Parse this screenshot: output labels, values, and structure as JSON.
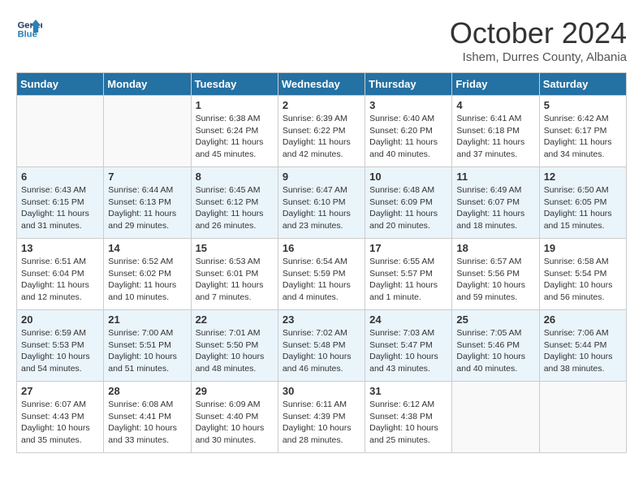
{
  "header": {
    "logo_line1": "General",
    "logo_line2": "Blue",
    "month": "October 2024",
    "location": "Ishem, Durres County, Albania"
  },
  "weekdays": [
    "Sunday",
    "Monday",
    "Tuesday",
    "Wednesday",
    "Thursday",
    "Friday",
    "Saturday"
  ],
  "weeks": [
    [
      {
        "day": "",
        "info": ""
      },
      {
        "day": "",
        "info": ""
      },
      {
        "day": "1",
        "info": "Sunrise: 6:38 AM\nSunset: 6:24 PM\nDaylight: 11 hours and 45 minutes."
      },
      {
        "day": "2",
        "info": "Sunrise: 6:39 AM\nSunset: 6:22 PM\nDaylight: 11 hours and 42 minutes."
      },
      {
        "day": "3",
        "info": "Sunrise: 6:40 AM\nSunset: 6:20 PM\nDaylight: 11 hours and 40 minutes."
      },
      {
        "day": "4",
        "info": "Sunrise: 6:41 AM\nSunset: 6:18 PM\nDaylight: 11 hours and 37 minutes."
      },
      {
        "day": "5",
        "info": "Sunrise: 6:42 AM\nSunset: 6:17 PM\nDaylight: 11 hours and 34 minutes."
      }
    ],
    [
      {
        "day": "6",
        "info": "Sunrise: 6:43 AM\nSunset: 6:15 PM\nDaylight: 11 hours and 31 minutes."
      },
      {
        "day": "7",
        "info": "Sunrise: 6:44 AM\nSunset: 6:13 PM\nDaylight: 11 hours and 29 minutes."
      },
      {
        "day": "8",
        "info": "Sunrise: 6:45 AM\nSunset: 6:12 PM\nDaylight: 11 hours and 26 minutes."
      },
      {
        "day": "9",
        "info": "Sunrise: 6:47 AM\nSunset: 6:10 PM\nDaylight: 11 hours and 23 minutes."
      },
      {
        "day": "10",
        "info": "Sunrise: 6:48 AM\nSunset: 6:09 PM\nDaylight: 11 hours and 20 minutes."
      },
      {
        "day": "11",
        "info": "Sunrise: 6:49 AM\nSunset: 6:07 PM\nDaylight: 11 hours and 18 minutes."
      },
      {
        "day": "12",
        "info": "Sunrise: 6:50 AM\nSunset: 6:05 PM\nDaylight: 11 hours and 15 minutes."
      }
    ],
    [
      {
        "day": "13",
        "info": "Sunrise: 6:51 AM\nSunset: 6:04 PM\nDaylight: 11 hours and 12 minutes."
      },
      {
        "day": "14",
        "info": "Sunrise: 6:52 AM\nSunset: 6:02 PM\nDaylight: 11 hours and 10 minutes."
      },
      {
        "day": "15",
        "info": "Sunrise: 6:53 AM\nSunset: 6:01 PM\nDaylight: 11 hours and 7 minutes."
      },
      {
        "day": "16",
        "info": "Sunrise: 6:54 AM\nSunset: 5:59 PM\nDaylight: 11 hours and 4 minutes."
      },
      {
        "day": "17",
        "info": "Sunrise: 6:55 AM\nSunset: 5:57 PM\nDaylight: 11 hours and 1 minute."
      },
      {
        "day": "18",
        "info": "Sunrise: 6:57 AM\nSunset: 5:56 PM\nDaylight: 10 hours and 59 minutes."
      },
      {
        "day": "19",
        "info": "Sunrise: 6:58 AM\nSunset: 5:54 PM\nDaylight: 10 hours and 56 minutes."
      }
    ],
    [
      {
        "day": "20",
        "info": "Sunrise: 6:59 AM\nSunset: 5:53 PM\nDaylight: 10 hours and 54 minutes."
      },
      {
        "day": "21",
        "info": "Sunrise: 7:00 AM\nSunset: 5:51 PM\nDaylight: 10 hours and 51 minutes."
      },
      {
        "day": "22",
        "info": "Sunrise: 7:01 AM\nSunset: 5:50 PM\nDaylight: 10 hours and 48 minutes."
      },
      {
        "day": "23",
        "info": "Sunrise: 7:02 AM\nSunset: 5:48 PM\nDaylight: 10 hours and 46 minutes."
      },
      {
        "day": "24",
        "info": "Sunrise: 7:03 AM\nSunset: 5:47 PM\nDaylight: 10 hours and 43 minutes."
      },
      {
        "day": "25",
        "info": "Sunrise: 7:05 AM\nSunset: 5:46 PM\nDaylight: 10 hours and 40 minutes."
      },
      {
        "day": "26",
        "info": "Sunrise: 7:06 AM\nSunset: 5:44 PM\nDaylight: 10 hours and 38 minutes."
      }
    ],
    [
      {
        "day": "27",
        "info": "Sunrise: 6:07 AM\nSunset: 4:43 PM\nDaylight: 10 hours and 35 minutes."
      },
      {
        "day": "28",
        "info": "Sunrise: 6:08 AM\nSunset: 4:41 PM\nDaylight: 10 hours and 33 minutes."
      },
      {
        "day": "29",
        "info": "Sunrise: 6:09 AM\nSunset: 4:40 PM\nDaylight: 10 hours and 30 minutes."
      },
      {
        "day": "30",
        "info": "Sunrise: 6:11 AM\nSunset: 4:39 PM\nDaylight: 10 hours and 28 minutes."
      },
      {
        "day": "31",
        "info": "Sunrise: 6:12 AM\nSunset: 4:38 PM\nDaylight: 10 hours and 25 minutes."
      },
      {
        "day": "",
        "info": ""
      },
      {
        "day": "",
        "info": ""
      }
    ]
  ]
}
